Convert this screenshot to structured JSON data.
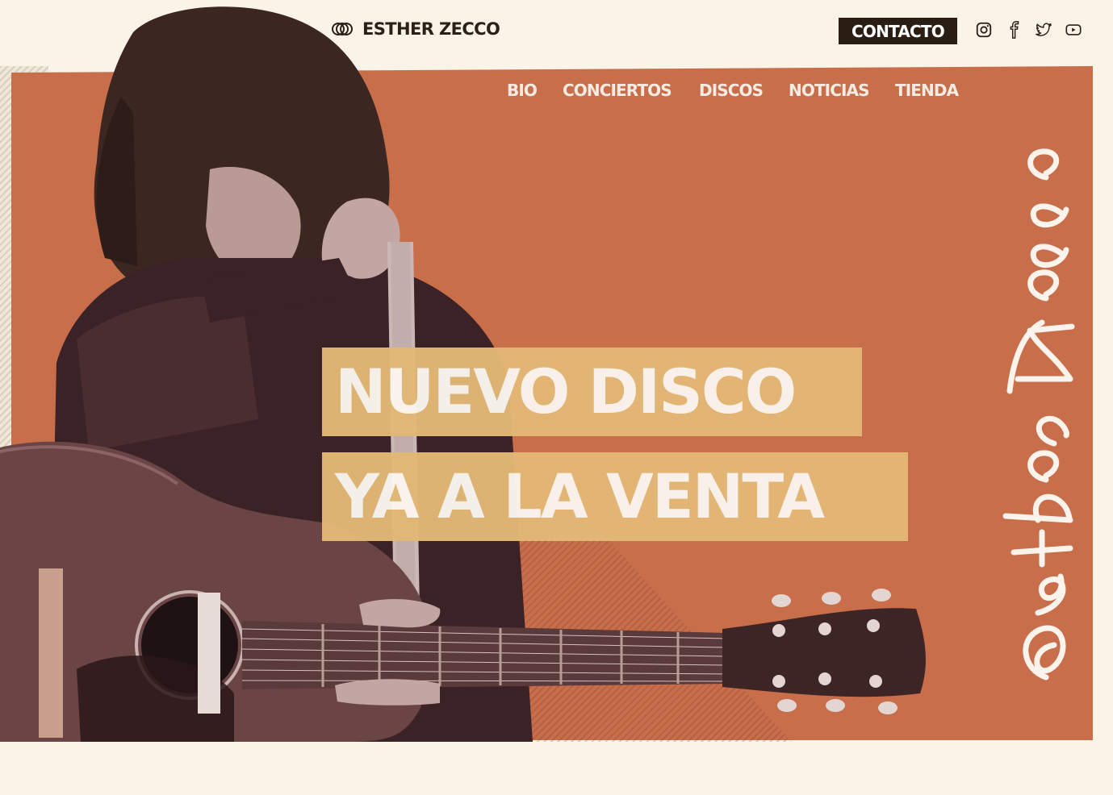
{
  "header": {
    "brand_name": "ESTHER ZECCO",
    "contact_label": "CONTACTO",
    "social": [
      {
        "icon": "instagram-icon"
      },
      {
        "icon": "facebook-icon"
      },
      {
        "icon": "twitter-icon"
      },
      {
        "icon": "youtube-icon"
      }
    ]
  },
  "nav": {
    "items": [
      {
        "label": "BIO"
      },
      {
        "label": "CONCIERTOS"
      },
      {
        "label": "DISCOS"
      },
      {
        "label": "NOTICIAS"
      },
      {
        "label": "TIENDA"
      }
    ]
  },
  "hero": {
    "headline_line1": "NUEVO DISCO",
    "headline_line2": "YA A LA VENTA",
    "signature_text": "Esther Zecco",
    "photo_alt": "Artist holding an acoustic guitar"
  },
  "colors": {
    "background": "#f9f3e8",
    "hero_panel": "#c96e4a",
    "headline_box": "#e3b877",
    "button": "#2a1d14"
  }
}
